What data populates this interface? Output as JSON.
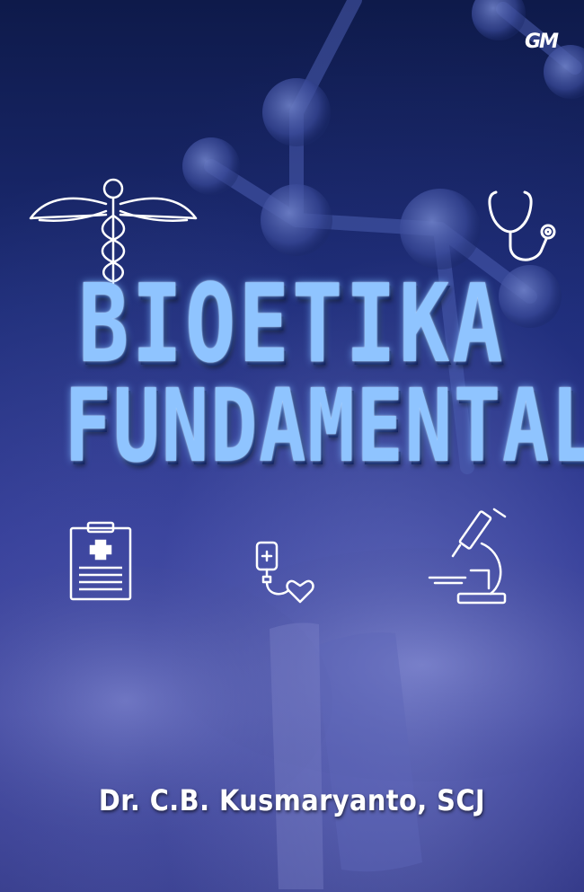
{
  "cover": {
    "publisher_logo": "GM",
    "title_line1": "BIOETIKA",
    "title_line2": "FUNDAMENTAL",
    "author": "Dr. C.B. Kusmaryanto, SCJ"
  },
  "icons": [
    "caduceus-icon",
    "stethoscope-icon",
    "clipboard-icon",
    "iv-bag-heart-icon",
    "microscope-icon"
  ],
  "colors": {
    "background": "#1d2c78",
    "title": "#8fc4ff",
    "author": "#ffffff"
  }
}
